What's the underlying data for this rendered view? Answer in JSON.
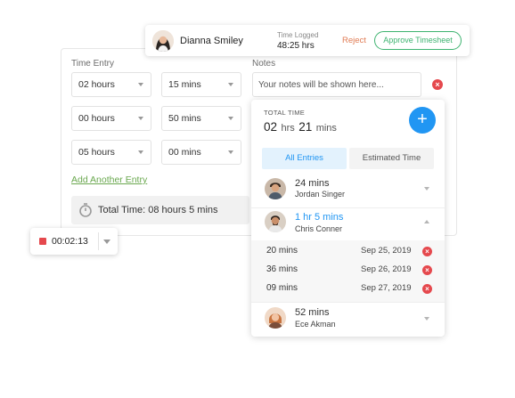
{
  "header": {
    "user_name": "Dianna Smiley",
    "time_logged_label": "Time Logged",
    "time_logged_value": "48:25 hrs",
    "reject_label": "Reject",
    "approve_label": "Approve Timesheet"
  },
  "form": {
    "time_entry_label": "Time Entry",
    "notes_label": "Notes",
    "notes_placeholder": "Your notes will be shown here...",
    "rows": [
      {
        "hours": "02 hours",
        "mins": "15 mins"
      },
      {
        "hours": "00 hours",
        "mins": "50 mins"
      },
      {
        "hours": "05 hours",
        "mins": "00 mins"
      }
    ],
    "add_entry_label": "Add Another Entry",
    "total_label": "Total Time: 08 hours 5 mins"
  },
  "timer": {
    "value": "00:02:13"
  },
  "panel": {
    "total_time_label": "TOTAL TIME",
    "total_hours_num": "02",
    "total_hours_unit": "hrs",
    "total_mins_num": "21",
    "total_mins_unit": "mins",
    "tabs": [
      "All Entries",
      "Estimated Time"
    ],
    "entries": [
      {
        "time": "24 mins",
        "name": "Jordan Singer"
      },
      {
        "time": "1 hr 5 mins",
        "name": "Chris Conner"
      },
      {
        "time": "52 mins",
        "name": "Ece Akman"
      }
    ],
    "sub_entries": [
      {
        "time": "20 mins",
        "date": "Sep 25, 2019"
      },
      {
        "time": "36 mins",
        "date": "Sep 26, 2019"
      },
      {
        "time": "09 mins",
        "date": "Sep 27, 2019"
      }
    ]
  },
  "colors": {
    "accent_blue": "#2196f3",
    "approve_green": "#3eb370",
    "reject_orange": "#e07b53",
    "remove_red": "#e5484d",
    "link_green": "#6aa84f"
  }
}
